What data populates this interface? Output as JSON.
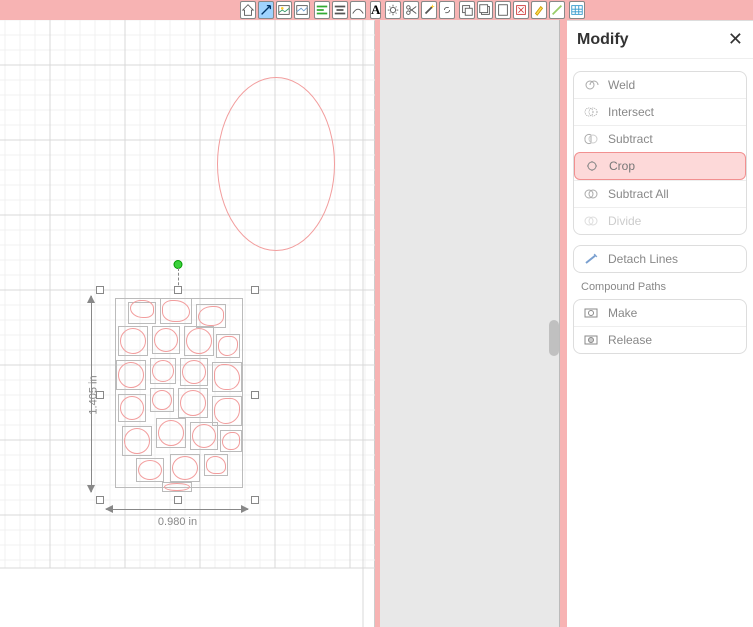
{
  "panel": {
    "title": "Modify",
    "shapeOps": {
      "weld": "Weld",
      "intersect": "Intersect",
      "subtract": "Subtract",
      "crop": "Crop",
      "subtractAll": "Subtract All",
      "divide": "Divide"
    },
    "detach": "Detach Lines",
    "compoundLabel": "Compound Paths",
    "compound": {
      "make": "Make",
      "release": "Release"
    }
  },
  "selection": {
    "widthLabel": "0.980 in",
    "heightLabel": "1.405 in"
  }
}
